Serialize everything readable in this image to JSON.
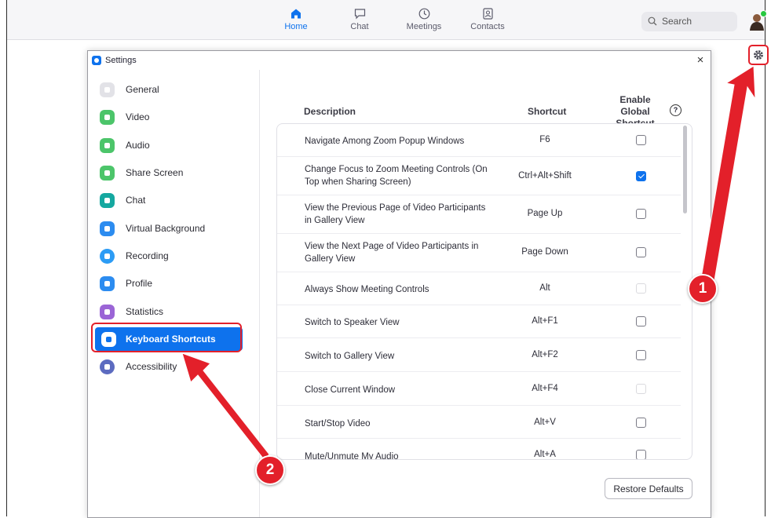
{
  "nav": {
    "items": [
      {
        "label": "Home",
        "icon": "home-icon",
        "active": true
      },
      {
        "label": "Chat",
        "icon": "chat-icon",
        "active": false
      },
      {
        "label": "Meetings",
        "icon": "clock-icon",
        "active": false
      },
      {
        "label": "Contacts",
        "icon": "contacts-icon",
        "active": false
      }
    ],
    "search_label": "Search"
  },
  "window": {
    "title": "Settings",
    "close": "×"
  },
  "sidebar": {
    "items": [
      {
        "label": "General",
        "color": "#e6e6ea"
      },
      {
        "label": "Video",
        "color": "#4cc56a"
      },
      {
        "label": "Audio",
        "color": "#4cc56a"
      },
      {
        "label": "Share Screen",
        "color": "#4cc56a"
      },
      {
        "label": "Chat",
        "color": "#15a8a0"
      },
      {
        "label": "Virtual Background",
        "color": "#2c8cf0"
      },
      {
        "label": "Recording",
        "color": "#2c9cf5"
      },
      {
        "label": "Profile",
        "color": "#2c8cf0"
      },
      {
        "label": "Statistics",
        "color": "#9b65d6"
      },
      {
        "label": "Keyboard Shortcuts",
        "color": "#0e72ed",
        "active": true
      },
      {
        "label": "Accessibility",
        "color": "#5c6bc0"
      }
    ]
  },
  "table": {
    "headers": {
      "description": "Description",
      "shortcut": "Shortcut",
      "global_line1": "Enable Global",
      "global_line2": "Shortcut",
      "help": "?"
    },
    "rows": [
      {
        "description": "Navigate Among Zoom Popup Windows",
        "shortcut": "F6",
        "state": "unchecked"
      },
      {
        "description": "Change Focus to Zoom Meeting Controls (On Top when Sharing Screen)",
        "shortcut": "Ctrl+Alt+Shift",
        "state": "checked"
      },
      {
        "description": "View the Previous Page of Video Participants in Gallery View",
        "shortcut": "Page Up",
        "state": "unchecked"
      },
      {
        "description": "View the Next Page of Video Participants in Gallery View",
        "shortcut": "Page Down",
        "state": "unchecked"
      },
      {
        "description": "Always Show Meeting Controls",
        "shortcut": "Alt",
        "state": "disabled"
      },
      {
        "description": "Switch to Speaker View",
        "shortcut": "Alt+F1",
        "state": "unchecked"
      },
      {
        "description": "Switch to Gallery View",
        "shortcut": "Alt+F2",
        "state": "unchecked"
      },
      {
        "description": "Close Current Window",
        "shortcut": "Alt+F4",
        "state": "disabled"
      },
      {
        "description": "Start/Stop Video",
        "shortcut": "Alt+V",
        "state": "unchecked"
      },
      {
        "description": "Mute/Unmute My Audio",
        "shortcut": "Alt+A",
        "state": "unchecked"
      }
    ]
  },
  "restore_label": "Restore Defaults",
  "annotations": {
    "badge1": "1",
    "badge2": "2",
    "color": "#e3202a"
  }
}
